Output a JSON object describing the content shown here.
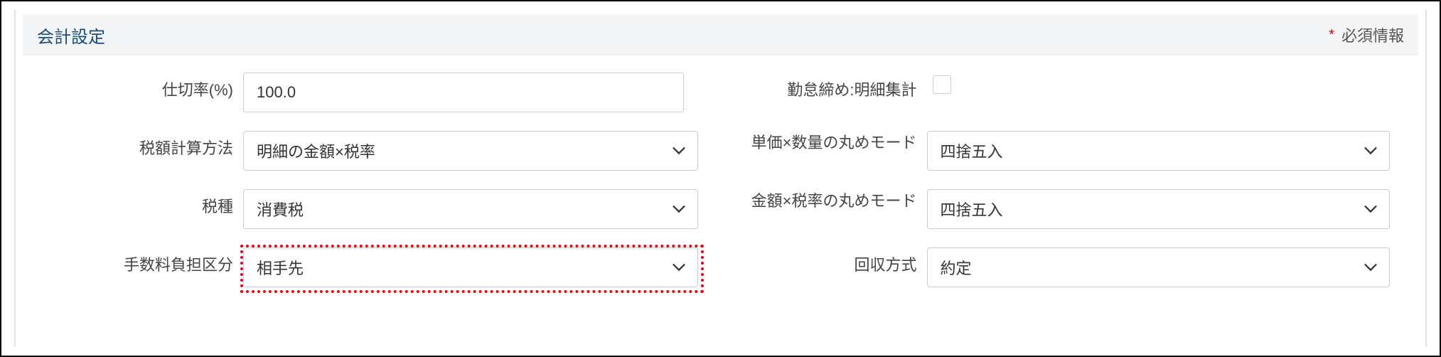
{
  "section": {
    "title": "会計設定",
    "required_label": "必須情報"
  },
  "fields": {
    "partition_rate": {
      "label": "仕切率(%)",
      "value": "100.0"
    },
    "attendance_close": {
      "label": "勤怠締め:明細集計",
      "checked": false
    },
    "tax_calc_method": {
      "label": "税額計算方法",
      "value": "明細の金額×税率"
    },
    "unit_qty_rounding": {
      "label": "単価×数量の丸めモード",
      "value": "四捨五入"
    },
    "tax_type": {
      "label": "税種",
      "value": "消費税"
    },
    "amount_rate_rounding": {
      "label": "金額×税率の丸めモード",
      "value": "四捨五入"
    },
    "fee_burden_class": {
      "label": "手数料負担区分",
      "value": "相手先"
    },
    "collection_method": {
      "label": "回収方式",
      "value": "約定"
    }
  }
}
